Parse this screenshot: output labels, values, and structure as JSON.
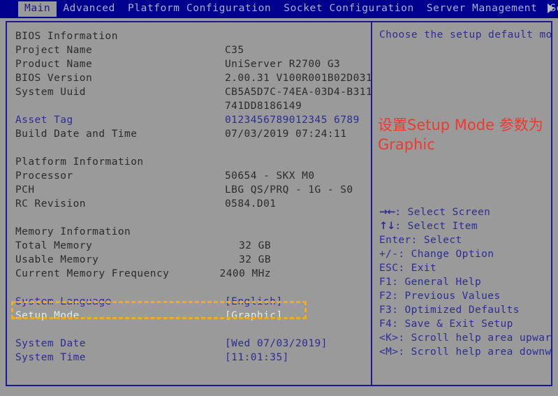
{
  "menubar": {
    "tabs": [
      {
        "label": "Main",
        "selected": true
      },
      {
        "label": "Advanced",
        "selected": false
      },
      {
        "label": "Platform Configuration",
        "selected": false
      },
      {
        "label": "Socket Configuration",
        "selected": false
      },
      {
        "label": "Server Management",
        "selected": false
      },
      {
        "label": "Security",
        "selected": false
      }
    ],
    "scroll_right_icon": "triangle-right-icon"
  },
  "main": {
    "sections": [
      {
        "heading": "BIOS Information",
        "rows": [
          {
            "label": "Project Name",
            "value": "C35",
            "style": "dark",
            "align": "left"
          },
          {
            "label": "Product Name",
            "value": "UniServer R2700 G3",
            "style": "dark",
            "align": "left"
          },
          {
            "label": "BIOS Version",
            "value": "2.00.31 V100R001B02D031",
            "style": "dark",
            "align": "left"
          },
          {
            "label": "System Uuid",
            "value": "CB5A5D7C-74EA-03D4-B311-",
            "style": "dark",
            "align": "left"
          },
          {
            "label": "",
            "value": "741DD8186149",
            "style": "dark",
            "align": "left"
          },
          {
            "label": "Asset Tag",
            "value": "0123456789012345 6789",
            "style": "blue",
            "align": "left"
          },
          {
            "label": "Build Date and Time",
            "value": "07/03/2019 07:24:11",
            "style": "dark",
            "align": "left"
          }
        ]
      },
      {
        "heading": "Platform Information",
        "rows": [
          {
            "label": "Processor",
            "value": "50654 - SKX M0",
            "style": "dark",
            "align": "left"
          },
          {
            "label": "PCH",
            "value": "LBG QS/PRQ - 1G - S0",
            "style": "dark",
            "align": "left"
          },
          {
            "label": "RC Revision",
            "value": "0584.D01",
            "style": "dark",
            "align": "left"
          }
        ]
      },
      {
        "heading": "Memory Information",
        "rows": [
          {
            "label": "Total Memory",
            "value": "32 GB",
            "style": "dark",
            "align": "right"
          },
          {
            "label": "Usable Memory",
            "value": "32 GB",
            "style": "dark",
            "align": "right"
          },
          {
            "label": "Current Memory Frequency",
            "value": "2400 MHz",
            "style": "dark",
            "align": "right"
          }
        ]
      }
    ],
    "settings": [
      {
        "label": "System Language",
        "value": "[English]",
        "style": "blue",
        "highlighted": false
      },
      {
        "label": "Setup Mode",
        "value": "[Graphic]",
        "style": "white",
        "highlighted": true
      },
      {
        "label": "System Date",
        "value": "[Wed 07/03/2019]",
        "style": "blue",
        "highlighted": false
      },
      {
        "label": "System Time",
        "value": "[11:01:35]",
        "style": "blue",
        "highlighted": false
      }
    ]
  },
  "help": {
    "title": "Choose the setup default mode",
    "annotation": "设置Setup Mode 参数为Graphic",
    "keys": [
      {
        "glyph": "→←",
        "text": ": Select Screen"
      },
      {
        "glyph": "↑↓",
        "text": ": Select Item"
      },
      {
        "glyph": "",
        "text": "Enter: Select"
      },
      {
        "glyph": "",
        "text": "+/-: Change Option"
      },
      {
        "glyph": "",
        "text": "ESC: Exit"
      },
      {
        "glyph": "",
        "text": "F1: General Help"
      },
      {
        "glyph": "",
        "text": "F2: Previous Values"
      },
      {
        "glyph": "",
        "text": "F3: Optimized Defaults"
      },
      {
        "glyph": "",
        "text": "F4: Save & Exit Setup"
      },
      {
        "glyph": "",
        "text": "<K>: Scroll help area upwards"
      },
      {
        "glyph": "",
        "text": "<M>: Scroll help area downwards"
      }
    ]
  },
  "colors": {
    "menubar_bg": "#00008f",
    "panel_bg": "#9a9a9a",
    "border": "#1a1a8c",
    "text_blue": "#2c2c96",
    "text_dark": "#2b2b2b",
    "text_white": "#e8e8e8",
    "highlight_orange": "#f0ab1e",
    "annotation_red": "#f2372f"
  }
}
